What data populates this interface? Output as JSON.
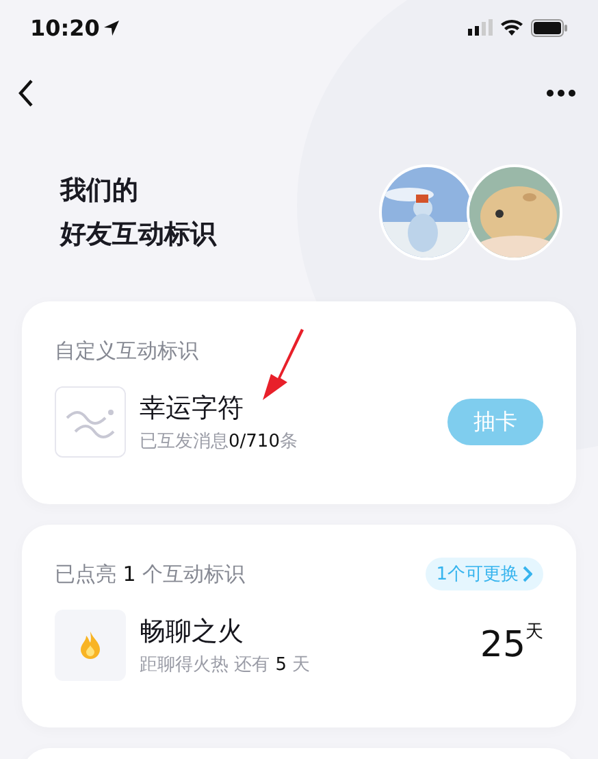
{
  "status_bar": {
    "time": "10:20"
  },
  "title": [
    "我们的",
    "好友互动标识"
  ],
  "custom_card": {
    "heading": "自定义互动标识",
    "item": {
      "name": "幸运字符",
      "detail": "已互发消息**0/710**条",
      "button": {
        "label": "抽卡",
        "disabled": true
      }
    }
  },
  "lit_card": {
    "heading": "已点亮 **1** 个互动标识",
    "swap_link": "1个可更换",
    "items": [
      {
        "name": "畅聊之火",
        "detail": "距聊得火热 还有 **5** 天",
        "days": "25",
        "unit": "天"
      }
    ]
  },
  "annotation": {
    "kind": "arrow"
  }
}
